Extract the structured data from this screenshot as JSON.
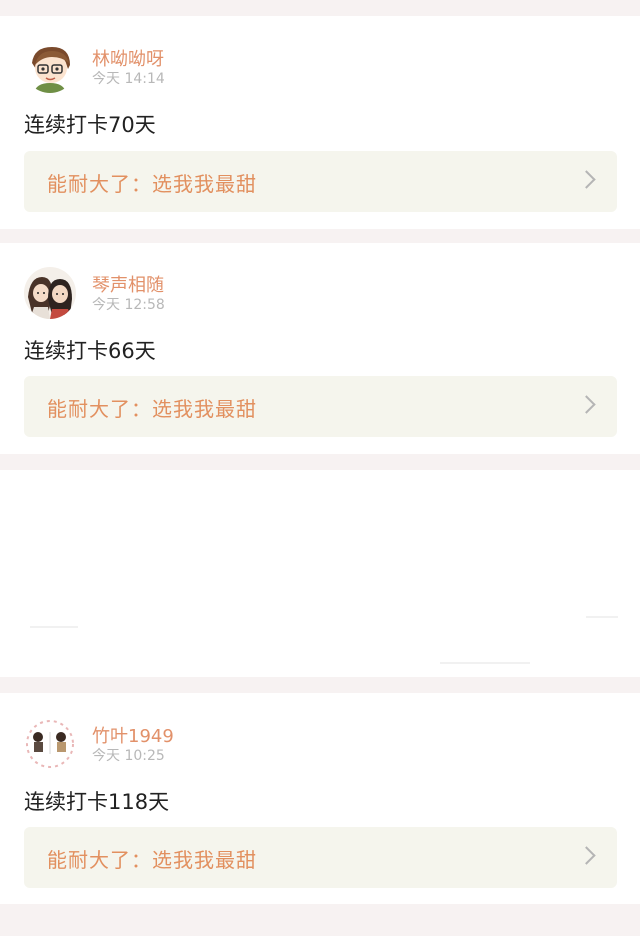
{
  "posts": [
    {
      "username": "林呦呦呀",
      "time": "今天 14:14",
      "text": "连续打卡70天",
      "quote": "能耐大了：选我我最甜",
      "avatar_icon": "cartoon-boy-avatar"
    },
    {
      "username": "琴声相随",
      "time": "今天 12:58",
      "text": "连续打卡66天",
      "quote": "能耐大了：选我我最甜",
      "avatar_icon": "couple-anime-avatar"
    },
    {
      "username": "竹叶1949",
      "time": "今天 10:25",
      "text": "连续打卡118天",
      "quote": "能耐大了：选我我最甜",
      "avatar_icon": "chibi-couple-avatar"
    }
  ],
  "icons": {
    "chevron": "chevron-right-icon"
  },
  "colors": {
    "username": "#e2916a",
    "quote_text": "#e2905f",
    "quote_bg": "#f5f5ed",
    "timestamp": "#b8b8b8",
    "page_bg": "#f7f2f2"
  }
}
